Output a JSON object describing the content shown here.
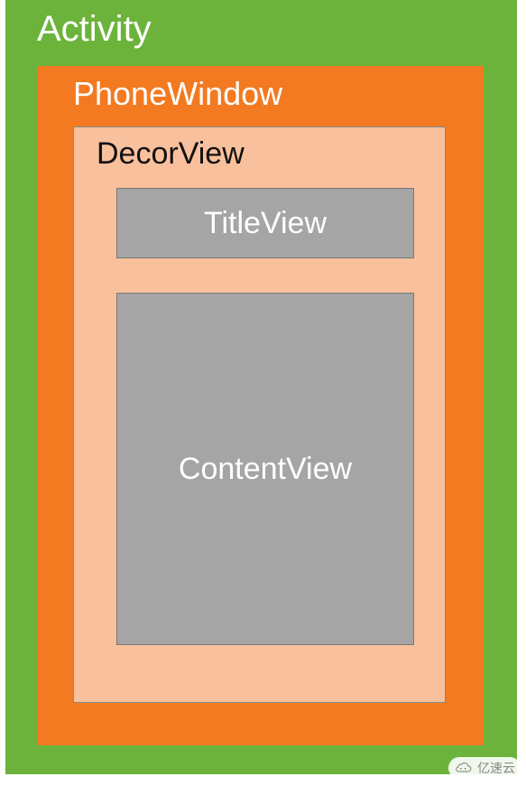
{
  "diagram": {
    "activity": {
      "label": "Activity"
    },
    "phoneWindow": {
      "label": "PhoneWindow"
    },
    "decorView": {
      "label": "DecorView"
    },
    "titleView": {
      "label": "TitleView"
    },
    "contentView": {
      "label": "ContentView"
    }
  },
  "watermark": {
    "text": "亿速云"
  },
  "colors": {
    "activityBg": "#6cb33b",
    "phoneWindowBg": "#f37a21",
    "decorViewBg": "#f9c09d",
    "viewBg": "#a5a5a5"
  }
}
